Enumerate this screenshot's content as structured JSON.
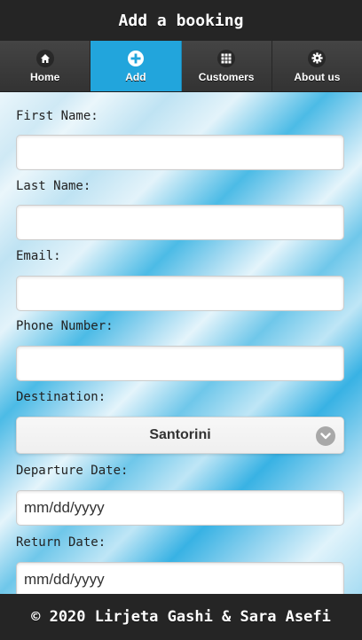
{
  "header": {
    "title": "Add a booking"
  },
  "nav": {
    "items": [
      {
        "label": "Home",
        "icon": "home-icon"
      },
      {
        "label": "Add",
        "icon": "plus-icon",
        "active": true
      },
      {
        "label": "Customers",
        "icon": "grid-icon"
      },
      {
        "label": "About us",
        "icon": "gear-icon"
      }
    ]
  },
  "form": {
    "first_name": {
      "label": "First Name:",
      "value": ""
    },
    "last_name": {
      "label": "Last Name:",
      "value": ""
    },
    "email": {
      "label": "Email:",
      "value": ""
    },
    "phone": {
      "label": "Phone Number:",
      "value": ""
    },
    "destination": {
      "label": "Destination:",
      "selected": "Santorini",
      "icon": "chevron-down-icon"
    },
    "departure": {
      "label": "Departure Date:",
      "placeholder": "mm/dd/yyyy"
    },
    "return": {
      "label": "Return Date:",
      "placeholder": "mm/dd/yyyy"
    }
  },
  "footer": {
    "text": "© 2020 Lirjeta Gashi & Sara Asefi"
  },
  "colors": {
    "header_bg": "#252525",
    "nav_active": "#22a5dc",
    "nav_bg": "#3a3a3a"
  }
}
